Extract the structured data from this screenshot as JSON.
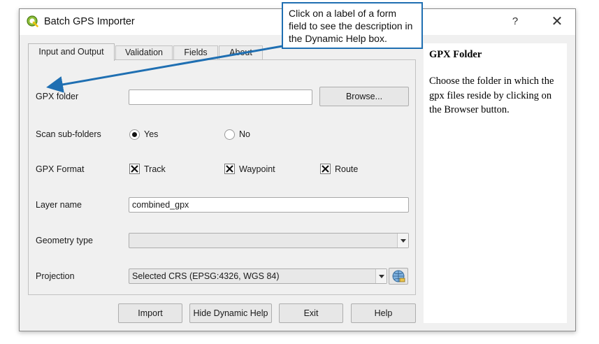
{
  "window": {
    "title": "Batch GPS Importer",
    "help_glyph": "?",
    "close_glyph": "✕",
    "app_icon": "qgis-logo-icon"
  },
  "tabs": [
    {
      "label": "Input and Output",
      "active": true
    },
    {
      "label": "Validation",
      "active": false
    },
    {
      "label": "Fields",
      "active": false
    },
    {
      "label": "About",
      "active": false
    }
  ],
  "form": {
    "gpx_folder": {
      "label": "GPX folder",
      "value": "",
      "browse_label": "Browse..."
    },
    "scan_subfolders": {
      "label": "Scan sub-folders",
      "options": [
        {
          "label": "Yes",
          "checked": true
        },
        {
          "label": "No",
          "checked": false
        }
      ]
    },
    "gpx_format": {
      "label": "GPX Format",
      "options": [
        {
          "label": "Track",
          "checked": true
        },
        {
          "label": "Waypoint",
          "checked": true
        },
        {
          "label": "Route",
          "checked": true
        }
      ]
    },
    "layer_name": {
      "label": "Layer name",
      "value": "combined_gpx"
    },
    "geometry_type": {
      "label": "Geometry type",
      "value": ""
    },
    "projection": {
      "label": "Projection",
      "value": "Selected CRS (EPSG:4326, WGS 84)",
      "crs_icon": "globe-icon"
    }
  },
  "buttons": {
    "import": "Import",
    "hide_help": "Hide Dynamic Help",
    "exit": "Exit",
    "help": "Help"
  },
  "help_panel": {
    "title": "GPX Folder",
    "body": "Choose the folder in which the gpx files reside by clicking on the Browser button."
  },
  "callout": {
    "text": "Click on a label of a form field to see the description in the Dynamic Help box.",
    "border_color": "#1f6fb2"
  }
}
